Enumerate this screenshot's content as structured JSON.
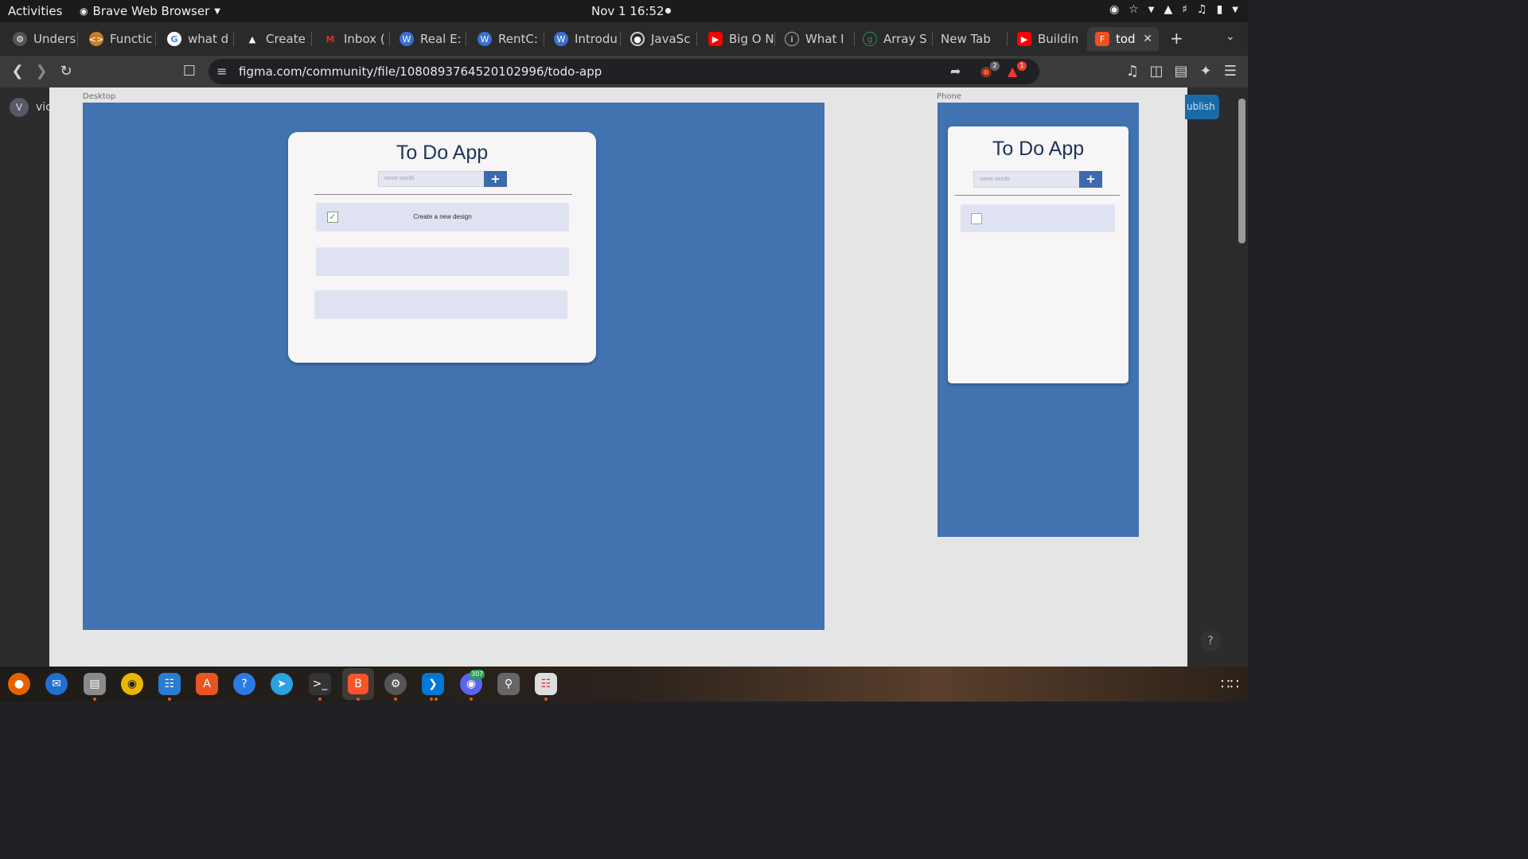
{
  "system_bar": {
    "activities": "Activities",
    "app_name": "Brave Web Browser",
    "clock": "Nov 1  16:52"
  },
  "tabs": [
    {
      "label": "Unders",
      "icon": "gear-icon",
      "color": "#555555"
    },
    {
      "label": "Functic",
      "icon": "code-icon",
      "color": "#c77d2a"
    },
    {
      "label": "what d",
      "icon": "google-icon",
      "color": "#ffffff"
    },
    {
      "label": "Create",
      "icon": "triangle-icon",
      "color": "#2a2a2a"
    },
    {
      "label": "Inbox (",
      "icon": "gmail-icon",
      "color": "#d93025"
    },
    {
      "label": "Real E:",
      "icon": "w-icon",
      "color": "#3b6fd1"
    },
    {
      "label": "RentC:",
      "icon": "w-icon",
      "color": "#3b6fd1"
    },
    {
      "label": "Introdu",
      "icon": "w-icon",
      "color": "#3b6fd1"
    },
    {
      "label": "JavaSc",
      "icon": "target-icon",
      "color": "#444444"
    },
    {
      "label": "Big O N",
      "icon": "youtube-icon",
      "color": "#ff0000"
    },
    {
      "label": "What I",
      "icon": "info-icon",
      "color": "#444444"
    },
    {
      "label": "Array S",
      "icon": "gfg-icon",
      "color": "#2f8d46"
    },
    {
      "label": "New Tab",
      "icon": "",
      "color": ""
    },
    {
      "label": "Buildin",
      "icon": "youtube-icon",
      "color": "#ff0000"
    },
    {
      "label": "tod",
      "icon": "figma-icon",
      "color": "#f24e1e"
    }
  ],
  "address_bar": {
    "url": "figma.com/community/file/1080893764520102996/todo-app",
    "shields_count": "2",
    "rewards_count": "1"
  },
  "figma": {
    "avatar_letter": "V",
    "user_name": "vic",
    "publish_label": "ublish",
    "help_label": "?",
    "desktop_frame_label": "Desktop",
    "phone_frame_label": "Phone"
  },
  "desktop_app": {
    "title": "To Do App",
    "input_placeholder": "some words",
    "add_label": "+",
    "todos": [
      {
        "text": "Create a new design",
        "checked": true
      },
      {
        "text": "",
        "checked": false
      },
      {
        "text": "",
        "checked": false
      }
    ]
  },
  "phone_app": {
    "title": "To Do App",
    "input_placeholder": "some words",
    "add_label": "+"
  },
  "dock": {
    "discord_badge": "307"
  }
}
